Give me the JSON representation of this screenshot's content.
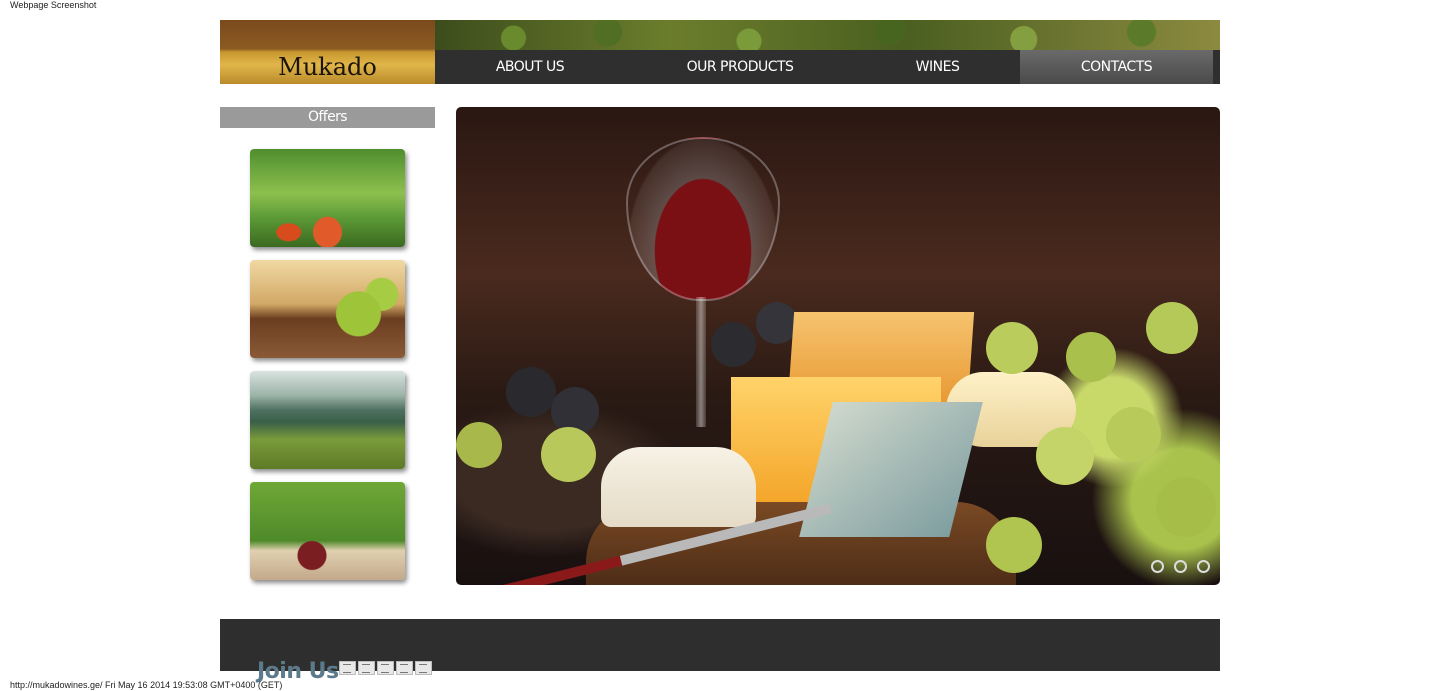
{
  "page": {
    "top_caption": "Webpage Screenshot",
    "bottom_caption": "http://mukadowines.ge/ Fri May 16 2014 19:53:08 GMT+0400 (GET)"
  },
  "header": {
    "logo_text": "Mukado",
    "nav": [
      {
        "label": "ABOUT US",
        "active": false
      },
      {
        "label": "OUR PRODUCTS",
        "active": false
      },
      {
        "label": "WINES",
        "active": false
      },
      {
        "label": "CONTACTS",
        "active": true
      }
    ]
  },
  "sidebar": {
    "title": "Offers",
    "thumbnails": [
      {
        "subject": "wine-glasses-and-roses"
      },
      {
        "subject": "green-grapes-on-barrel"
      },
      {
        "subject": "vineyard-valley"
      },
      {
        "subject": "red-wine-glasses-outdoors"
      }
    ]
  },
  "slider": {
    "subject": "wine-cheese-and-grapes",
    "slide_count": 3,
    "active_slide": 1
  },
  "footer": {
    "join_label": "Join Us",
    "social_icon_count": 5
  }
}
